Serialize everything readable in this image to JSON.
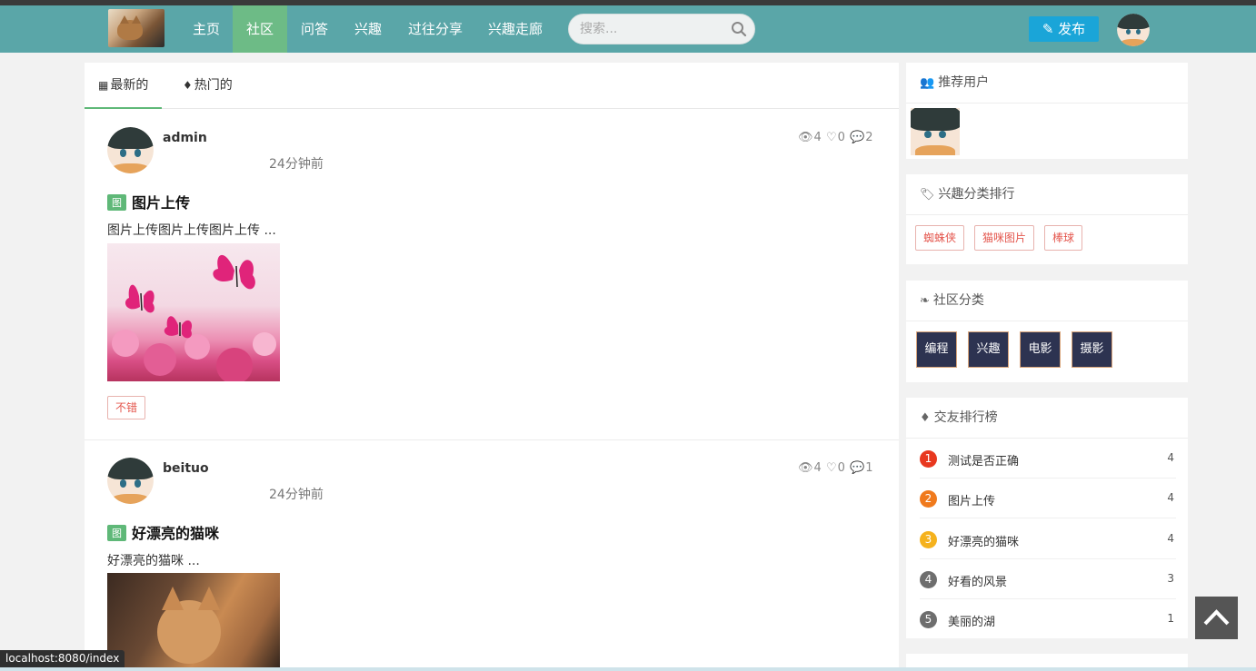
{
  "nav": {
    "items": [
      "主页",
      "社区",
      "问答",
      "兴趣",
      "过往分享",
      "兴趣走廊"
    ],
    "active_index": 1,
    "search_placeholder": "搜索...",
    "publish_label": "发布"
  },
  "tabs": [
    "最新的",
    "热门的"
  ],
  "posts": [
    {
      "user": "admin",
      "time": "24分钟前",
      "views": "4",
      "likes": "0",
      "comments": "2",
      "badge": "图",
      "title": "图片上传",
      "excerpt": "图片上传图片上传图片上传 ...",
      "tag": "不错"
    },
    {
      "user": "beituo",
      "time": "24分钟前",
      "views": "4",
      "likes": "0",
      "comments": "1",
      "badge": "图",
      "title": "好漂亮的猫咪",
      "excerpt": "好漂亮的猫咪 ..."
    }
  ],
  "sidebar": {
    "recommended_title": "推荐用户",
    "interest_title": "兴趣分类排行",
    "interest_tags": [
      "蜘蛛侠",
      "猫咪图片",
      "棒球"
    ],
    "community_title": "社区分类",
    "community_categories": [
      "编程",
      "兴趣",
      "电影",
      "摄影"
    ],
    "ranking_title": "交友排行榜",
    "ranking": [
      {
        "rank": "1",
        "title": "测试是否正确",
        "count": "4",
        "color": "#e8381f"
      },
      {
        "rank": "2",
        "title": "图片上传",
        "count": "4",
        "color": "#f07a1d"
      },
      {
        "rank": "3",
        "title": "好漂亮的猫咪",
        "count": "4",
        "color": "#f5b21d"
      },
      {
        "rank": "4",
        "title": "好看的风景",
        "count": "3",
        "color": "#6e6e6e"
      },
      {
        "rank": "5",
        "title": "美丽的湖",
        "count": "1",
        "color": "#6e6e6e"
      }
    ]
  },
  "status_url": "localhost:8080/index",
  "colors": {
    "navbar": "#5aa6a8",
    "nav_active": "#6dbb86",
    "publish": "#1aa5d8",
    "badge": "#5fb878",
    "category_button": "#2d3351"
  }
}
